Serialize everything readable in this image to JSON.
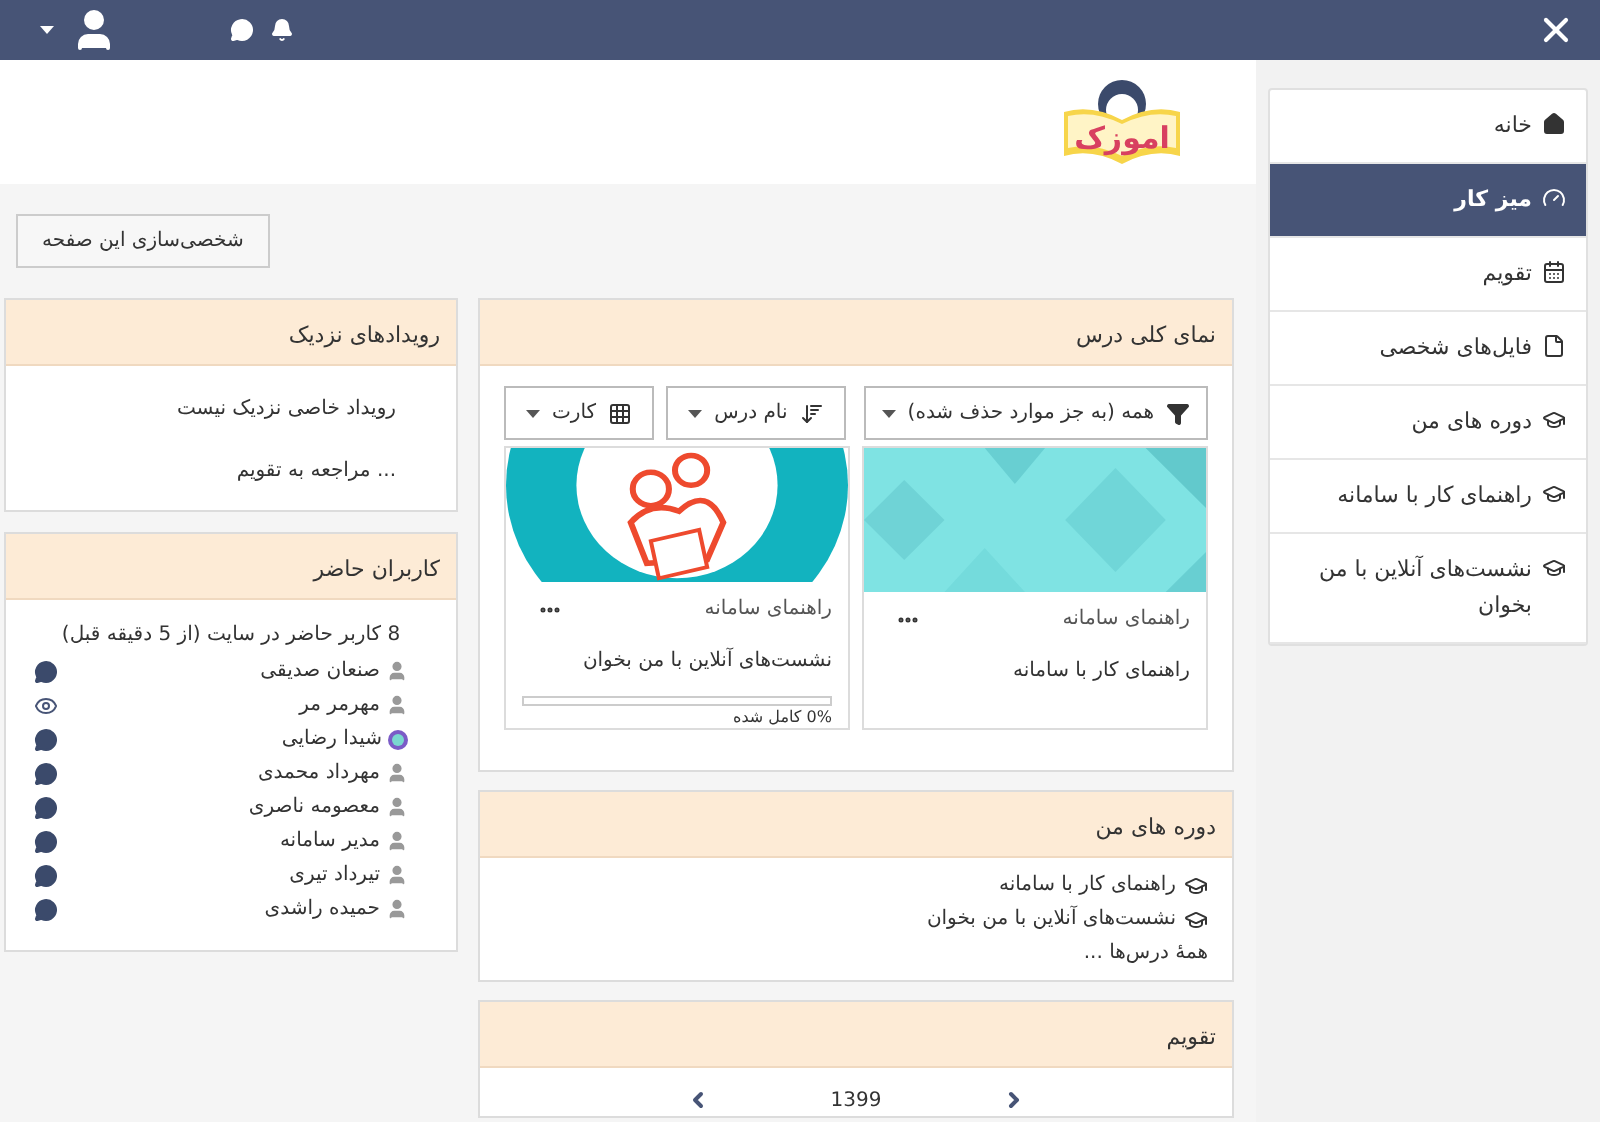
{
  "logo": {
    "text": "اموزک"
  },
  "nav": [
    {
      "label": "خانه",
      "kind": "home",
      "selected": false
    },
    {
      "label": "میز کار",
      "kind": "dashboard",
      "selected": true
    },
    {
      "label": "تقویم",
      "kind": "calendar",
      "selected": false
    },
    {
      "label": "فایل‌های شخصی",
      "kind": "file",
      "selected": false
    },
    {
      "label": "دوره های من",
      "kind": "course",
      "selected": false
    },
    {
      "label": "راهنمای کار با سامانه",
      "kind": "course",
      "selected": false
    },
    {
      "label": "نشست‌های آنلاین با من بخوان",
      "kind": "course",
      "selected": false
    }
  ],
  "customize_button": "شخصی‌سازی این صفحه",
  "course_overview": {
    "title": "نمای کلی درس",
    "filters": [
      {
        "label": "همه (به جز موارد حذف شده)",
        "kind": "filter"
      },
      {
        "label": "نام درس",
        "kind": "sort"
      },
      {
        "label": "کارت",
        "kind": "view"
      }
    ],
    "courses": [
      {
        "category": "راهنمای سامانه",
        "title": "راهنمای کار با سامانه",
        "kind": "pattern"
      },
      {
        "category": "راهنمای سامانه",
        "title": "نشست‌های آنلاین با من بخوان",
        "kind": "reading",
        "progress": {
          "level": 0,
          "text": "0% کامل شده"
        }
      }
    ]
  },
  "my_courses": {
    "title": "دوره های من",
    "items": [
      "راهنمای کار با سامانه",
      "نشست‌های آنلاین با من بخوان"
    ],
    "all_link": "همهٔ درس‌ها ..."
  },
  "calendar": {
    "title": "تقویم",
    "year": "1399"
  },
  "upcoming_events": {
    "title": "رویدادهای نزدیک",
    "empty": "رویداد خاصی نزدیک نیست",
    "link": "... مراجعه به تقویم"
  },
  "online_users": {
    "title": "کاربران حاضر",
    "summary": "8 کاربر حاضر در سایت (از 5 دقیقه قبل)",
    "users": [
      {
        "name": "صنعان صدیقی",
        "avatar": {
          "kind": "default"
        },
        "action": {
          "kind": "message"
        }
      },
      {
        "name": "مهرمر مر",
        "avatar": {
          "kind": "default"
        },
        "action": {
          "kind": "eye"
        }
      },
      {
        "name": "شیدا رضایی",
        "action": {
          "kind": "message"
        }
      },
      {
        "name": "مهرداد محمدی",
        "avatar": {
          "kind": "default"
        },
        "action": {
          "kind": "message"
        }
      },
      {
        "name": "معصومه ناصری",
        "avatar": {
          "kind": "default"
        },
        "action": {
          "kind": "message"
        }
      },
      {
        "name": "مدیر سامانه",
        "avatar": {
          "kind": "default"
        },
        "action": {
          "kind": "message"
        }
      },
      {
        "name": "تیرداد تیری",
        "avatar": {
          "kind": "default"
        },
        "action": {
          "kind": "message"
        }
      },
      {
        "name": "حمیده راشدی",
        "avatar": {
          "kind": "default"
        },
        "action": {
          "kind": "message"
        }
      }
    ]
  }
}
